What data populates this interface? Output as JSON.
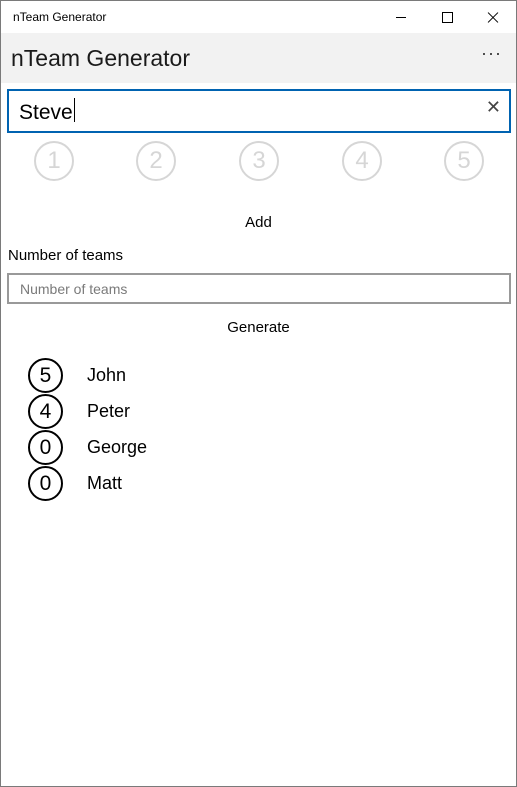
{
  "window": {
    "title": "nTeam Generator"
  },
  "app": {
    "title": "nTeam Generator",
    "more_label": "···"
  },
  "name_input": {
    "value": "Steve",
    "clear_label": "✕"
  },
  "ratings": [
    "1",
    "2",
    "3",
    "4",
    "5"
  ],
  "add_label": "Add",
  "teams": {
    "label": "Number of teams",
    "placeholder": "Number of teams",
    "value": ""
  },
  "generate_label": "Generate",
  "players": [
    {
      "score": "5",
      "name": "John"
    },
    {
      "score": "4",
      "name": "Peter"
    },
    {
      "score": "0",
      "name": "George"
    },
    {
      "score": "0",
      "name": "Matt"
    }
  ]
}
